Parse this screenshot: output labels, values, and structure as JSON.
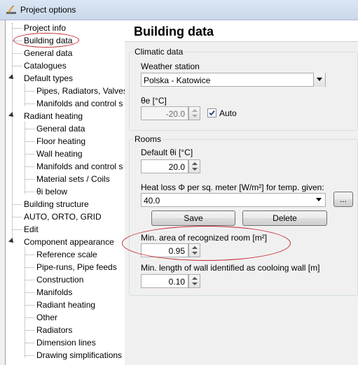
{
  "window": {
    "title": "Project options"
  },
  "tree": {
    "items": [
      "Project info",
      "Building data",
      "General data",
      "Catalogues",
      "Default types",
      "Pipes, Radiators, Valves",
      "Manifolds and control s",
      "Radiant heating",
      "General data",
      "Floor heating",
      "Wall heating",
      "Manifolds and control s",
      "Material sets / Coils",
      "θi below",
      "Building structure",
      "AUTO, ORTO, GRID",
      "Edit",
      "Component appearance",
      "Reference scale",
      "Pipe-runs, Pipe feeds",
      "Construction",
      "Manifolds",
      "Radiant heating",
      "Other",
      "Radiators",
      "Dimension lines",
      "Drawing simplifications"
    ]
  },
  "main": {
    "title": "Building data",
    "climatic": {
      "group_label": "Climatic data",
      "station_label": "Weather station",
      "station_value": "Polska - Katowice",
      "theta_e_label": "θe [°C]",
      "theta_e_value": "-20.0",
      "auto_label": "Auto",
      "auto_checked": true
    },
    "rooms": {
      "group_label": "Rooms",
      "theta_i_label": "Default θi [°C]",
      "theta_i_value": "20.0",
      "heatloss_label": "Heat loss Φ per sq. meter [W/m²] for temp. given:",
      "heatloss_value": "40.0",
      "ellipsis_label": "...",
      "save_label": "Save",
      "delete_label": "Delete",
      "min_area_label": "Min. area of recognized room [m²]",
      "min_area_value": "0.95",
      "min_wall_label": "Min. length of wall identified as cooloing wall [m]",
      "min_wall_value": "0.10"
    }
  },
  "colors": {
    "highlight": "#c1272d",
    "accent": "#4a8fd6"
  }
}
